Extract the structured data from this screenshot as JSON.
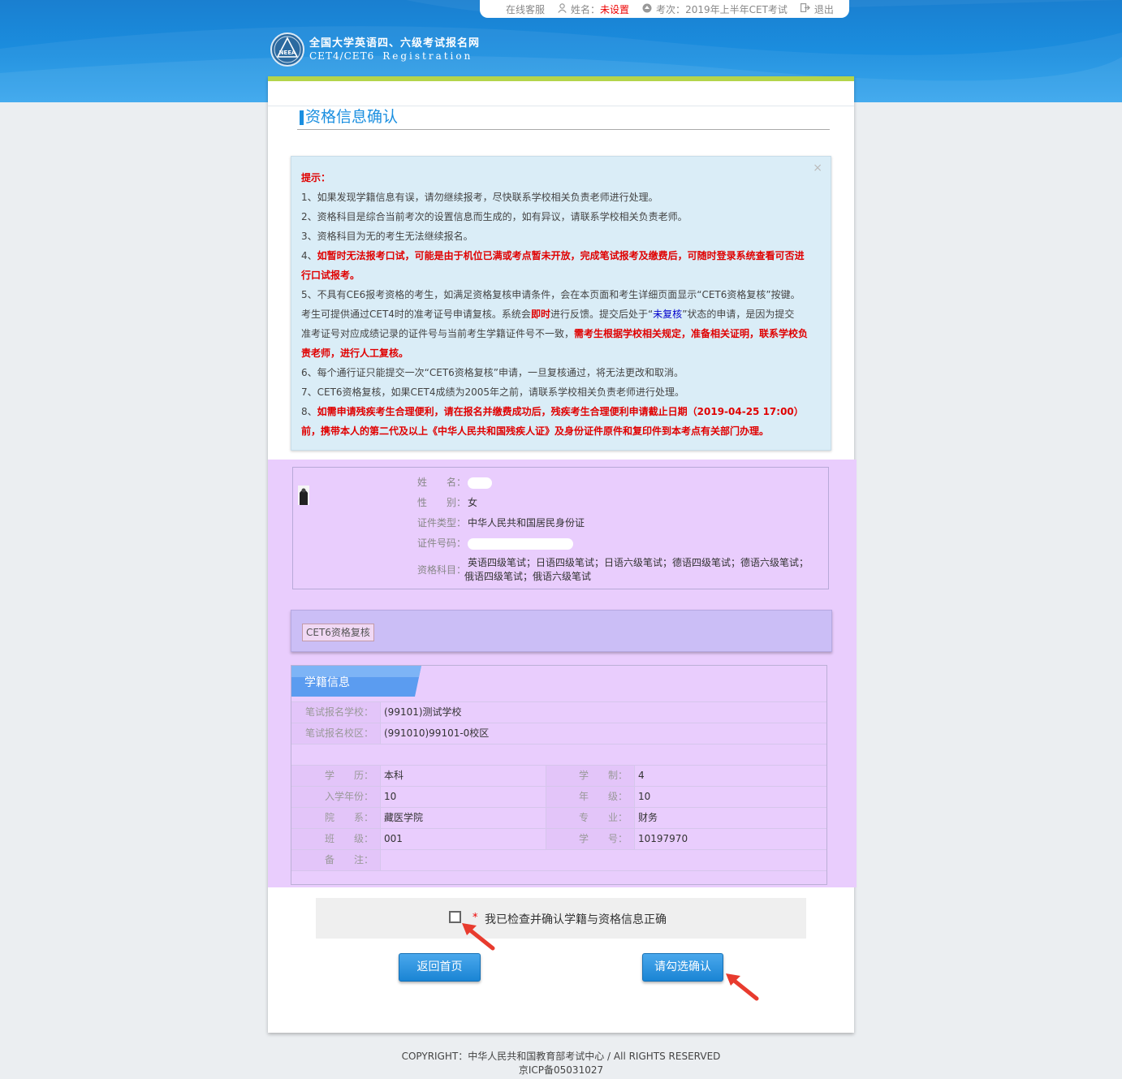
{
  "topbar": {
    "service": "在线客服",
    "name_label": "姓名：",
    "name_value": "未设置",
    "exam_label": "考次：",
    "exam_value": "2019年上半年CET考试",
    "logout": "退出"
  },
  "logo": {
    "cn": "全国大学英语四、六级考试报名网",
    "en1": "CET4/CET6",
    "en2": "Registration",
    "badge": "NEEA"
  },
  "page_title": "资格信息确认",
  "notice": {
    "heading": "提示：",
    "close": "×",
    "line1": "1、如果发现学籍信息有误，请勿继续报考，尽快联系学校相关负责老师进行处理。",
    "line2": "2、资格科目是综合当前考次的设置信息而生成的，如有异议，请联系学校相关负责老师。",
    "line3": "3、资格科目为无的考生无法继续报名。",
    "line4a": "4、",
    "line4b": "如暂时无法报考口试，可能是由于机位已满或考点暂未开放，完成笔试报考及缴费后，可随时登录系统查看可否进",
    "line4c": "行口试报考。",
    "line5a": "5、不具有CE6报考资格的考生，如满足资格复核申请条件，会在本页面和考生详细页面显示“CET6资格复核”按键。",
    "line5b1": "考生可提供通过CET4时的准考证号申请复核。系统会",
    "line5b2": "即时",
    "line5b3": "进行反馈。提交后处于“",
    "line5b4": "未复核",
    "line5b5": "”状态的申请，是因为提交",
    "line5c1": "准考证号对应成绩记录的证件号与当前考生学籍证件号不一致，",
    "line5c2": "需考生根据学校相关规定，准备相关证明，联系学校负",
    "line5d": "责老师，进行人工复核。",
    "line6": "6、每个通行证只能提交一次“CET6资格复核”申请，一旦复核通过，将无法更改和取消。",
    "line7": "7、CET6资格复核，如果CET4成绩为2005年之前，请联系学校相关负责老师进行处理。",
    "line8a": "8、",
    "line8b": "如需申请残疾考生合理便利，请在报名并缴费成功后，残疾考生合理便利申请截止日期（2019-04-25 17:00）",
    "line8c": "前，携带本人的第二代及以上《中华人民共和国残疾人证》及身份证件原件和复印件到本考点有关部门办理。"
  },
  "person": {
    "name_label": "姓　　名：",
    "gender_label": "性　　别：",
    "gender": "女",
    "idtype_label": "证件类型：",
    "idtype": "中华人民共和国居民身份证",
    "idno_label": "证件号码：",
    "subjects_label": "资格科目：",
    "subjects_line1": "英语四级笔试；日语四级笔试；日语六级笔试；德语四级笔试；德语六级笔试；",
    "subjects_line2": "俄语四级笔试；俄语六级笔试"
  },
  "review_button": "CET6资格复核",
  "school": {
    "tab": "学籍信息",
    "school_label": "笔试报名学校：",
    "school": "(99101)测试学校",
    "campus_label": "笔试报名校区：",
    "campus": "(991010)99101-0校区",
    "edu_label": "学　　历：",
    "edu": "本科",
    "length_label": "学　　制：",
    "length": "4",
    "year_label": "入学年份：",
    "year": "10",
    "grade_label": "年　　级：",
    "grade": "10",
    "dept_label": "院　　系：",
    "dept": "藏医学院",
    "major_label": "专　　业：",
    "major": "财务",
    "class_label": "班　　级：",
    "class": "001",
    "sid_label": "学　　号：",
    "sid": "10197970",
    "note_label": "备　　注：",
    "note": ""
  },
  "confirm": {
    "star": "*",
    "text": "我已检查并确认学籍与资格信息正确",
    "checked": false
  },
  "buttons": {
    "home": "返回首页",
    "confirm": "请勾选确认"
  },
  "footer": {
    "copyright": "COPYRIGHT：中华人民共和国教育部考试中心 / All RIGHTS RESERVED",
    "icp": "京ICP备05031027"
  },
  "colors": {
    "header_blue": "#1b8fe0",
    "accent_green": "#b4d44a",
    "purple_highlight": "#e9cdfd",
    "alert_red": "#e00000",
    "arrow_red": "#e83b2e"
  }
}
